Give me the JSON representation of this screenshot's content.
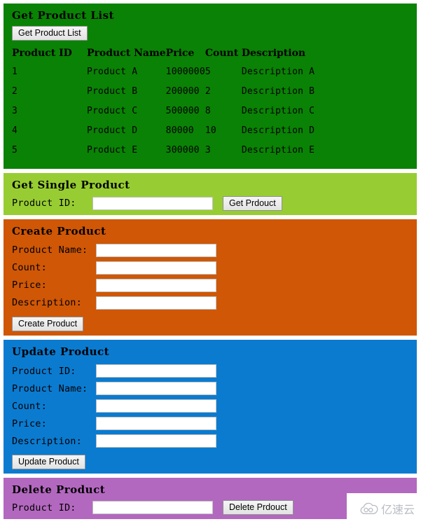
{
  "sections": {
    "list": {
      "title": "Get Product List",
      "button": "Get Product List",
      "columns": [
        "Product ID",
        "Product Name",
        "Price",
        "Count",
        "Description"
      ],
      "rows": [
        {
          "id": "1",
          "name": "Product A",
          "price": "1000000",
          "count": "5",
          "description": "Description A"
        },
        {
          "id": "2",
          "name": "Product B",
          "price": "200000",
          "count": "2",
          "description": "Description B"
        },
        {
          "id": "3",
          "name": "Product C",
          "price": "500000",
          "count": "8",
          "description": "Description C"
        },
        {
          "id": "4",
          "name": "Product D",
          "price": "80000",
          "count": "10",
          "description": "Description D"
        },
        {
          "id": "5",
          "name": "Product E",
          "price": "300000",
          "count": "3",
          "description": "Description E"
        }
      ]
    },
    "single": {
      "title": "Get Single Product",
      "id_label": "Product ID:",
      "id_value": "",
      "button": "Get Prdouct"
    },
    "create": {
      "title": "Create Product",
      "fields": [
        {
          "label": "Product Name:",
          "value": ""
        },
        {
          "label": "Count:",
          "value": ""
        },
        {
          "label": "Price:",
          "value": ""
        },
        {
          "label": "Description:",
          "value": ""
        }
      ],
      "button": "Create Product"
    },
    "update": {
      "title": "Update Product",
      "fields": [
        {
          "label": "Product ID:",
          "value": ""
        },
        {
          "label": "Product Name:",
          "value": ""
        },
        {
          "label": "Count:",
          "value": ""
        },
        {
          "label": "Price:",
          "value": ""
        },
        {
          "label": "Description:",
          "value": ""
        }
      ],
      "button": "Update Product"
    },
    "delete": {
      "title": "Delete Product",
      "id_label": "Product ID:",
      "id_value": "",
      "button": "Delete Prdouct"
    }
  },
  "watermark": {
    "text": "亿速云",
    "icon": "cloud-icon"
  },
  "colors": {
    "list_bg": "#0a8205",
    "single_bg": "#97cd32",
    "create_bg": "#cf5706",
    "update_bg": "#0b7bd0",
    "delete_bg": "#b368bf",
    "page_bg": "#ffffff"
  }
}
